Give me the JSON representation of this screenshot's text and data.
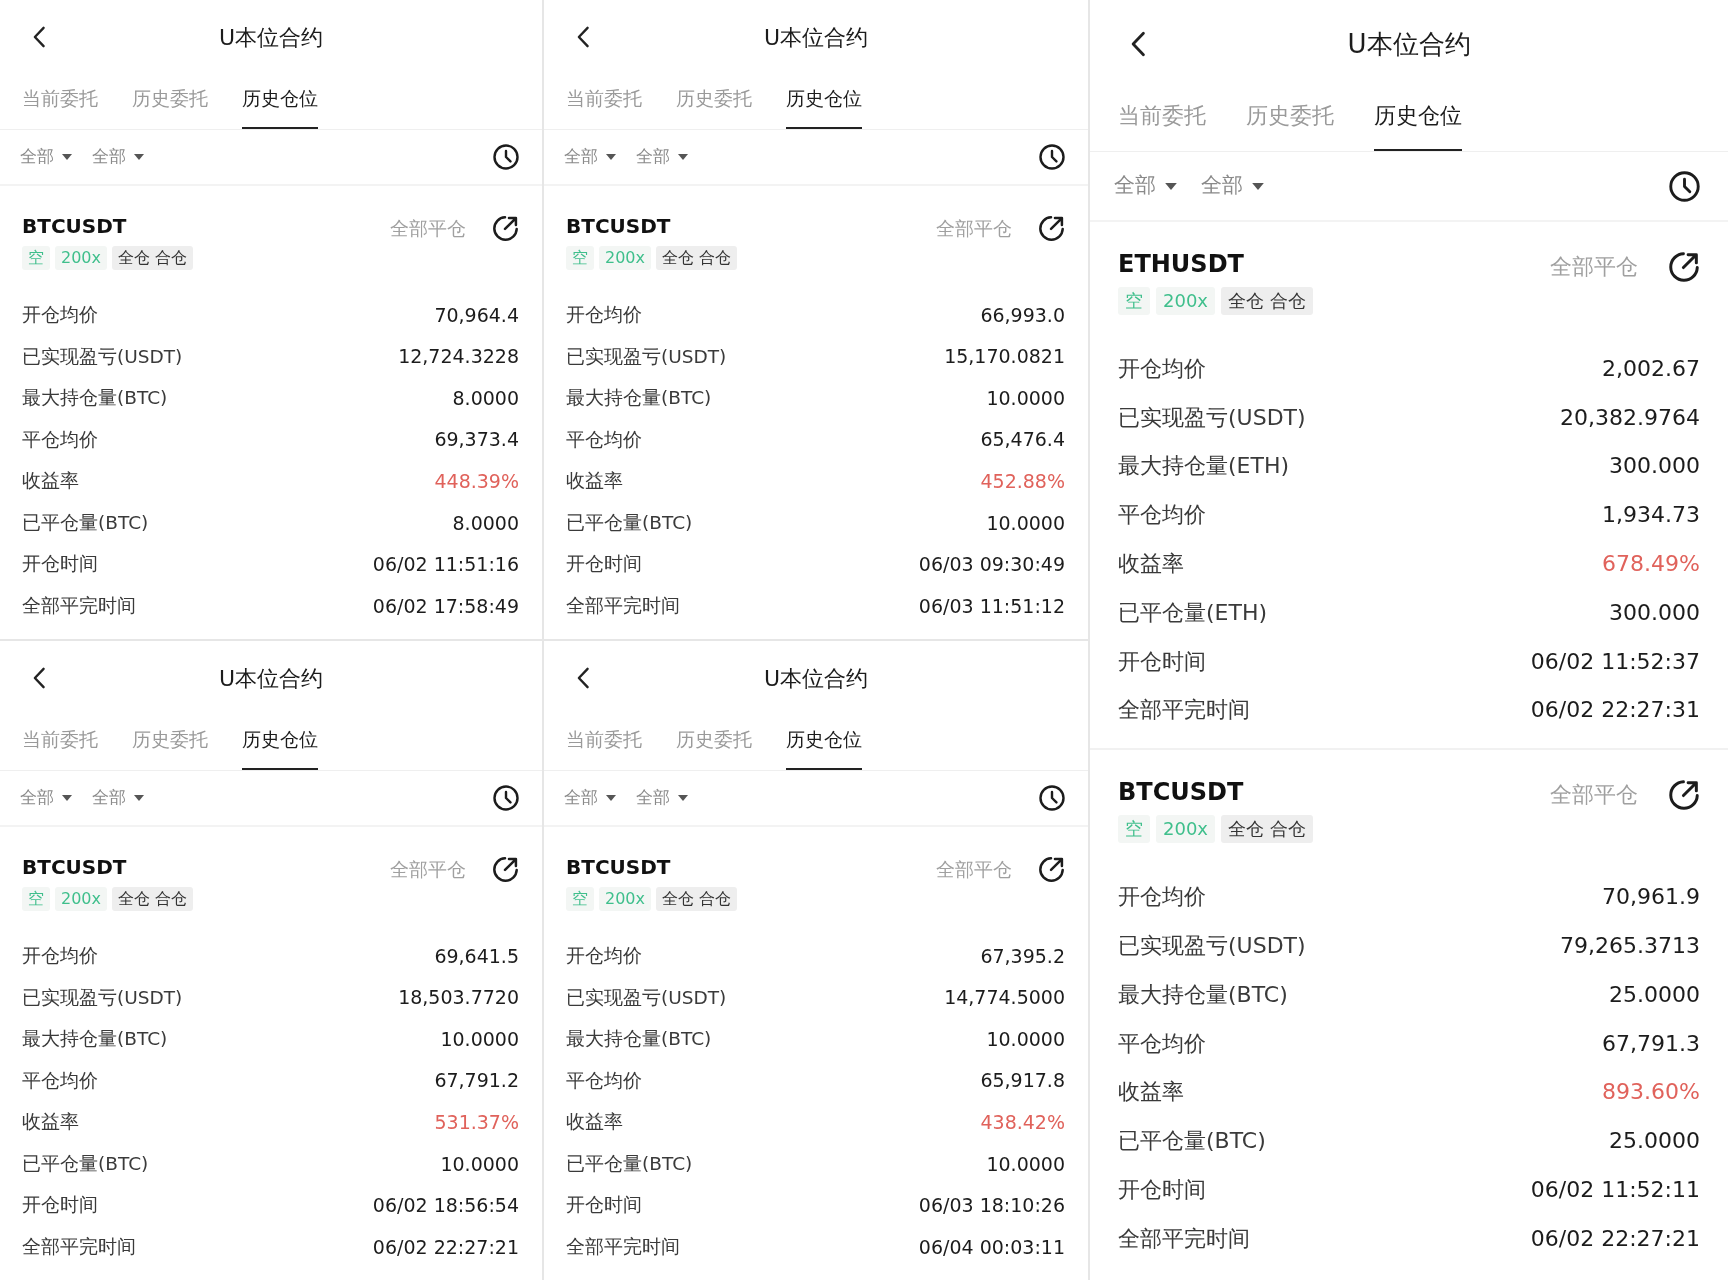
{
  "columns": [
    {
      "panels": [
        {
          "title": "U本位合约",
          "tabs": [
            {
              "label": "当前委托",
              "selected": false
            },
            {
              "label": "历史委托",
              "selected": false
            },
            {
              "label": "历史仓位",
              "selected": true
            }
          ],
          "filters": [
            "全部",
            "全部"
          ],
          "positions": [
            {
              "symbol": "BTCUSDT",
              "close_all": "全部平仓",
              "tags": [
                {
                  "label": "空",
                  "kind": "side"
                },
                {
                  "label": "200x",
                  "kind": "leverage"
                },
                {
                  "label": "全仓 合仓",
                  "kind": "mode"
                }
              ],
              "rows": [
                {
                  "label": "开仓均价",
                  "value": "70,964.4",
                  "kind": "plain"
                },
                {
                  "label": "已实现盈亏(USDT)",
                  "value": "12,724.3228",
                  "kind": "plain"
                },
                {
                  "label": "最大持仓量(BTC)",
                  "value": "8.0000",
                  "kind": "plain"
                },
                {
                  "label": "平仓均价",
                  "value": "69,373.4",
                  "kind": "plain"
                },
                {
                  "label": "收益率",
                  "value": "448.39%",
                  "kind": "gain"
                },
                {
                  "label": "已平仓量(BTC)",
                  "value": "8.0000",
                  "kind": "plain"
                },
                {
                  "label": "开仓时间",
                  "value": "06/02 11:51:16",
                  "kind": "plain"
                },
                {
                  "label": "全部平完时间",
                  "value": "06/02 17:58:49",
                  "kind": "plain"
                }
              ]
            }
          ]
        },
        {
          "title": "U本位合约",
          "tabs": [
            {
              "label": "当前委托",
              "selected": false
            },
            {
              "label": "历史委托",
              "selected": false
            },
            {
              "label": "历史仓位",
              "selected": true
            }
          ],
          "filters": [
            "全部",
            "全部"
          ],
          "positions": [
            {
              "symbol": "BTCUSDT",
              "close_all": "全部平仓",
              "tags": [
                {
                  "label": "空",
                  "kind": "side"
                },
                {
                  "label": "200x",
                  "kind": "leverage"
                },
                {
                  "label": "全仓 合仓",
                  "kind": "mode"
                }
              ],
              "rows": [
                {
                  "label": "开仓均价",
                  "value": "69,641.5",
                  "kind": "plain"
                },
                {
                  "label": "已实现盈亏(USDT)",
                  "value": "18,503.7720",
                  "kind": "plain"
                },
                {
                  "label": "最大持仓量(BTC)",
                  "value": "10.0000",
                  "kind": "plain"
                },
                {
                  "label": "平仓均价",
                  "value": "67,791.2",
                  "kind": "plain"
                },
                {
                  "label": "收益率",
                  "value": "531.37%",
                  "kind": "gain"
                },
                {
                  "label": "已平仓量(BTC)",
                  "value": "10.0000",
                  "kind": "plain"
                },
                {
                  "label": "开仓时间",
                  "value": "06/02 18:56:54",
                  "kind": "plain"
                },
                {
                  "label": "全部平完时间",
                  "value": "06/02 22:27:21",
                  "kind": "plain"
                }
              ]
            }
          ]
        }
      ]
    },
    {
      "panels": [
        {
          "title": "U本位合约",
          "tabs": [
            {
              "label": "当前委托",
              "selected": false
            },
            {
              "label": "历史委托",
              "selected": false
            },
            {
              "label": "历史仓位",
              "selected": true
            }
          ],
          "filters": [
            "全部",
            "全部"
          ],
          "positions": [
            {
              "symbol": "BTCUSDT",
              "close_all": "全部平仓",
              "tags": [
                {
                  "label": "空",
                  "kind": "side"
                },
                {
                  "label": "200x",
                  "kind": "leverage"
                },
                {
                  "label": "全仓 合仓",
                  "kind": "mode"
                }
              ],
              "rows": [
                {
                  "label": "开仓均价",
                  "value": "66,993.0",
                  "kind": "plain"
                },
                {
                  "label": "已实现盈亏(USDT)",
                  "value": "15,170.0821",
                  "kind": "plain"
                },
                {
                  "label": "最大持仓量(BTC)",
                  "value": "10.0000",
                  "kind": "plain"
                },
                {
                  "label": "平仓均价",
                  "value": "65,476.4",
                  "kind": "plain"
                },
                {
                  "label": "收益率",
                  "value": "452.88%",
                  "kind": "gain"
                },
                {
                  "label": "已平仓量(BTC)",
                  "value": "10.0000",
                  "kind": "plain"
                },
                {
                  "label": "开仓时间",
                  "value": "06/03 09:30:49",
                  "kind": "plain"
                },
                {
                  "label": "全部平完时间",
                  "value": "06/03 11:51:12",
                  "kind": "plain"
                }
              ]
            }
          ]
        },
        {
          "title": "U本位合约",
          "tabs": [
            {
              "label": "当前委托",
              "selected": false
            },
            {
              "label": "历史委托",
              "selected": false
            },
            {
              "label": "历史仓位",
              "selected": true
            }
          ],
          "filters": [
            "全部",
            "全部"
          ],
          "positions": [
            {
              "symbol": "BTCUSDT",
              "close_all": "全部平仓",
              "tags": [
                {
                  "label": "空",
                  "kind": "side"
                },
                {
                  "label": "200x",
                  "kind": "leverage"
                },
                {
                  "label": "全仓 合仓",
                  "kind": "mode"
                }
              ],
              "rows": [
                {
                  "label": "开仓均价",
                  "value": "67,395.2",
                  "kind": "plain"
                },
                {
                  "label": "已实现盈亏(USDT)",
                  "value": "14,774.5000",
                  "kind": "plain"
                },
                {
                  "label": "最大持仓量(BTC)",
                  "value": "10.0000",
                  "kind": "plain"
                },
                {
                  "label": "平仓均价",
                  "value": "65,917.8",
                  "kind": "plain"
                },
                {
                  "label": "收益率",
                  "value": "438.42%",
                  "kind": "gain"
                },
                {
                  "label": "已平仓量(BTC)",
                  "value": "10.0000",
                  "kind": "plain"
                },
                {
                  "label": "开仓时间",
                  "value": "06/03 18:10:26",
                  "kind": "plain"
                },
                {
                  "label": "全部平完时间",
                  "value": "06/04 00:03:11",
                  "kind": "plain"
                }
              ]
            }
          ]
        }
      ]
    },
    {
      "panels": [
        {
          "title": "U本位合约",
          "tabs": [
            {
              "label": "当前委托",
              "selected": false
            },
            {
              "label": "历史委托",
              "selected": false
            },
            {
              "label": "历史仓位",
              "selected": true
            }
          ],
          "filters": [
            "全部",
            "全部"
          ],
          "positions": [
            {
              "symbol": "ETHUSDT",
              "close_all": "全部平仓",
              "tags": [
                {
                  "label": "空",
                  "kind": "side"
                },
                {
                  "label": "200x",
                  "kind": "leverage"
                },
                {
                  "label": "全仓 合仓",
                  "kind": "mode"
                }
              ],
              "rows": [
                {
                  "label": "开仓均价",
                  "value": "2,002.67",
                  "kind": "plain"
                },
                {
                  "label": "已实现盈亏(USDT)",
                  "value": "20,382.9764",
                  "kind": "plain"
                },
                {
                  "label": "最大持仓量(ETH)",
                  "value": "300.000",
                  "kind": "plain"
                },
                {
                  "label": "平仓均价",
                  "value": "1,934.73",
                  "kind": "plain"
                },
                {
                  "label": "收益率",
                  "value": "678.49%",
                  "kind": "gain"
                },
                {
                  "label": "已平仓量(ETH)",
                  "value": "300.000",
                  "kind": "plain"
                },
                {
                  "label": "开仓时间",
                  "value": "06/02 11:52:37",
                  "kind": "plain"
                },
                {
                  "label": "全部平完时间",
                  "value": "06/02 22:27:31",
                  "kind": "plain"
                }
              ]
            },
            {
              "symbol": "BTCUSDT",
              "close_all": "全部平仓",
              "tags": [
                {
                  "label": "空",
                  "kind": "side"
                },
                {
                  "label": "200x",
                  "kind": "leverage"
                },
                {
                  "label": "全仓 合仓",
                  "kind": "mode"
                }
              ],
              "rows": [
                {
                  "label": "开仓均价",
                  "value": "70,961.9",
                  "kind": "plain"
                },
                {
                  "label": "已实现盈亏(USDT)",
                  "value": "79,265.3713",
                  "kind": "plain"
                },
                {
                  "label": "最大持仓量(BTC)",
                  "value": "25.0000",
                  "kind": "plain"
                },
                {
                  "label": "平仓均价",
                  "value": "67,791.3",
                  "kind": "plain"
                },
                {
                  "label": "收益率",
                  "value": "893.60%",
                  "kind": "gain"
                },
                {
                  "label": "已平仓量(BTC)",
                  "value": "25.0000",
                  "kind": "plain"
                },
                {
                  "label": "开仓时间",
                  "value": "06/02 11:52:11",
                  "kind": "plain"
                },
                {
                  "label": "全部平完时间",
                  "value": "06/02 22:27:21",
                  "kind": "plain"
                }
              ]
            }
          ]
        }
      ]
    }
  ]
}
